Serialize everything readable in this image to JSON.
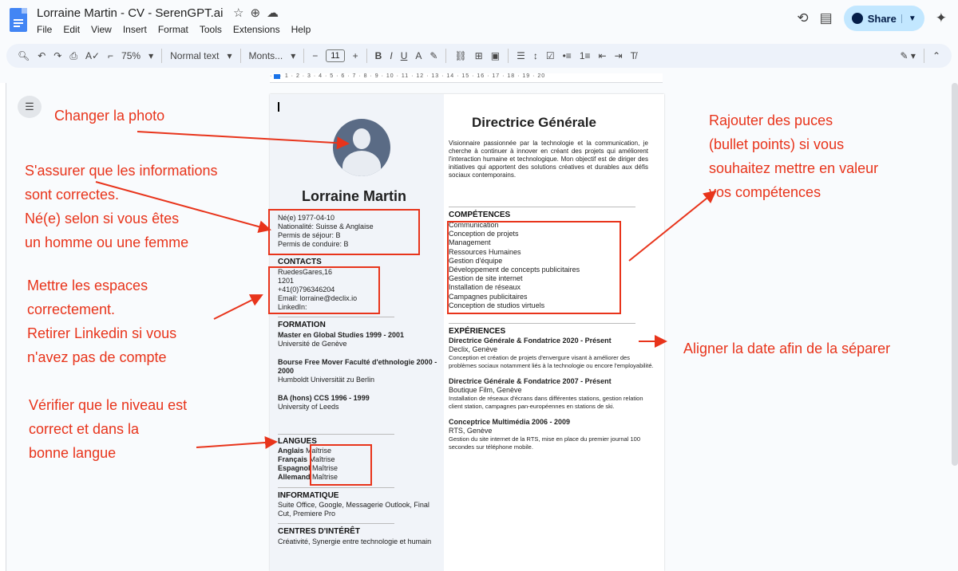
{
  "app": {
    "doc_title": "Lorraine Martin - CV - SerenGPT.ai",
    "menu": [
      "File",
      "Edit",
      "View",
      "Insert",
      "Format",
      "Tools",
      "Extensions",
      "Help"
    ],
    "share_label": "Share"
  },
  "toolbar": {
    "zoom": "75%",
    "style": "Normal text",
    "font": "Monts...",
    "font_size": "11"
  },
  "cv": {
    "name": "Lorraine Martin",
    "personal": [
      "Né(e) 1977-04-10",
      "Nationalité: Suisse & Anglaise",
      "Permis de séjour: B",
      "Permis de conduire: B"
    ],
    "contacts_heading": "CONTACTS",
    "contacts": [
      "RuedesGares,16",
      "1201",
      "+41(0)796346204",
      "Email: lorraine@declix.io",
      "LinkedIn:"
    ],
    "formation_heading": "FORMATION",
    "formation": [
      {
        "title": "Master en Global Studies 1999 - 2001",
        "place": "Université de Genève"
      },
      {
        "title": "Bourse Free Mover Faculté d'ethnologie 2000 - 2000",
        "place": "Humboldt Universität zu Berlin"
      },
      {
        "title": "BA (hons) CCS 1996 - 1999",
        "place": "University of Leeds"
      }
    ],
    "langues_heading": "LANGUES",
    "langues": [
      {
        "lang": "Anglais",
        "level": "Maîtrise"
      },
      {
        "lang": "Français",
        "level": "Maîtrise"
      },
      {
        "lang": "Espagnol",
        "level": "Maîtrise"
      },
      {
        "lang": "Allemand",
        "level": "Maîtrise"
      }
    ],
    "informatique_heading": "INFORMATIQUE",
    "informatique": "Suite Office, Google, Messagerie Outlook, Final Cut, Premiere Pro",
    "interets_heading": "CENTRES D'INTÉRÊT",
    "interets": "Créativité, Synergie entre technologie et humain",
    "job_title": "Directrice Générale",
    "summary": "Visionnaire passionnée par la technologie et la communication, je cherche à continuer à innover en créant des projets qui améliorent l'interaction humaine et technologique. Mon objectif est de diriger des initiatives qui apportent des solutions créatives et durables aux défis sociaux contemporains.",
    "competences_heading": "COMPÉTENCES",
    "competences": [
      "Communication",
      "Conception de projets",
      "Management",
      "Ressources Humaines",
      "Gestion d'équipe",
      "Développement de concepts publicitaires",
      "Gestion de site internet",
      "Installation de réseaux",
      "Campagnes publicitaires",
      "Conception de studios virtuels"
    ],
    "experiences_heading": "EXPÉRIENCES",
    "experiences": [
      {
        "title": "Directrice Générale & Fondatrice 2020 - Présent",
        "company": "Declix, Genève",
        "desc": "Conception et création de projets d'envergure visant à améliorer des problèmes sociaux notamment liés à la technologie ou encore l'employabilité."
      },
      {
        "title": "Directrice Générale & Fondatrice 2007 - Présent",
        "company": "Boutique Film, Genève",
        "desc": "Installation de réseaux d'écrans dans différentes stations, gestion relation client station, campagnes pan-européennes en stations de ski."
      },
      {
        "title": "Conceptrice Multimédia 2006 - 2009",
        "company": "RTS, Genève",
        "desc": "Gestion du site internet de la RTS, mise en place du premier journal 100 secondes sur téléphone mobile."
      }
    ]
  },
  "annotations": {
    "photo": "Changer la photo",
    "info": [
      "S'assurer que les informations",
      "sont correctes.",
      "Né(e) selon si vous êtes",
      "un homme ou une femme"
    ],
    "spaces": [
      "Mettre les espaces",
      "correctement.",
      "Retirer Linkedin si vous",
      "n'avez pas de compte"
    ],
    "level": [
      "Vérifier que le niveau est",
      "correct et dans la",
      "bonne langue"
    ],
    "bullets": [
      "Rajouter des puces",
      "(bullet points) si vous",
      "souhaitez mettre en valeur",
      "vos compétences"
    ],
    "date": "Aligner la date afin de la séparer"
  },
  "colors": {
    "annotation": "#e8341b",
    "share_bg": "#c2e7ff",
    "doc_icon": "#4285f4"
  }
}
